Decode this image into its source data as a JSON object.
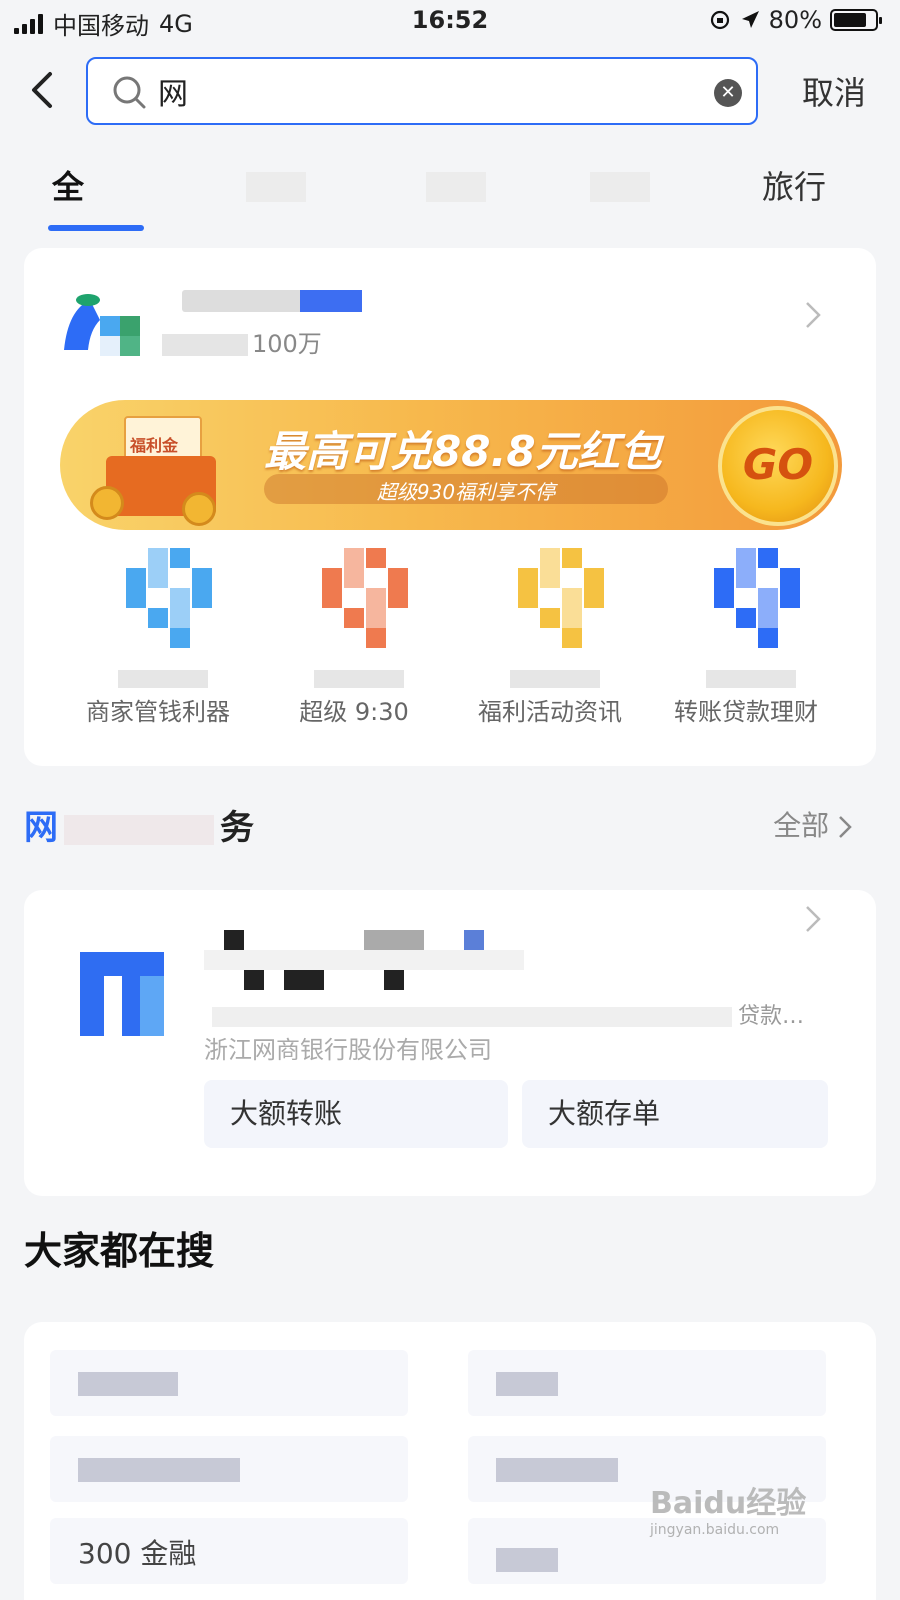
{
  "status_bar": {
    "carrier": "中国移动",
    "network": "4G",
    "time": "16:52",
    "battery": "80%",
    "battery_level": 0.8
  },
  "search": {
    "query": "网",
    "cancel_label": "取消"
  },
  "tabs": [
    {
      "label": "全",
      "active": true
    },
    {
      "label": ""
    },
    {
      "label": ""
    },
    {
      "label": ""
    },
    {
      "label": "旅行"
    }
  ],
  "app_result": {
    "subtitle": "100万"
  },
  "banner": {
    "gift_label": "福利金",
    "headline": "最高可兑88.8元红包",
    "subtext": "超级930福利享不停",
    "go_label": "GO"
  },
  "quick_links": [
    {
      "label": "商家管钱利器",
      "icon": "blue-mosaic-icon",
      "color": "#4aa8f0"
    },
    {
      "label": "超级 9:30",
      "icon": "orange-mosaic-icon",
      "color": "#ef7a4f"
    },
    {
      "label": "福利活动资讯",
      "icon": "yellow-mosaic-icon",
      "color": "#f5c242"
    },
    {
      "label": "转账贷款理财",
      "icon": "blue-dark-mosaic-icon",
      "color": "#2d6cf6"
    }
  ],
  "services_section": {
    "title_start": "网",
    "title_end": "务",
    "all_label": "全部"
  },
  "bank_service": {
    "desc_tail": "贷款…",
    "company": "浙江网商银行股份有限公司",
    "buttons": [
      "大额转账",
      "大额存单"
    ]
  },
  "hot_search": {
    "title": "大家都在搜",
    "items": [
      "",
      "",
      "",
      "",
      "300 金融",
      ""
    ]
  },
  "watermark": {
    "brand": "Baidu经验",
    "url": "jingyan.baidu.com"
  },
  "colors": {
    "accent": "#2d6cf6",
    "page_bg": "#f4f5f7"
  }
}
